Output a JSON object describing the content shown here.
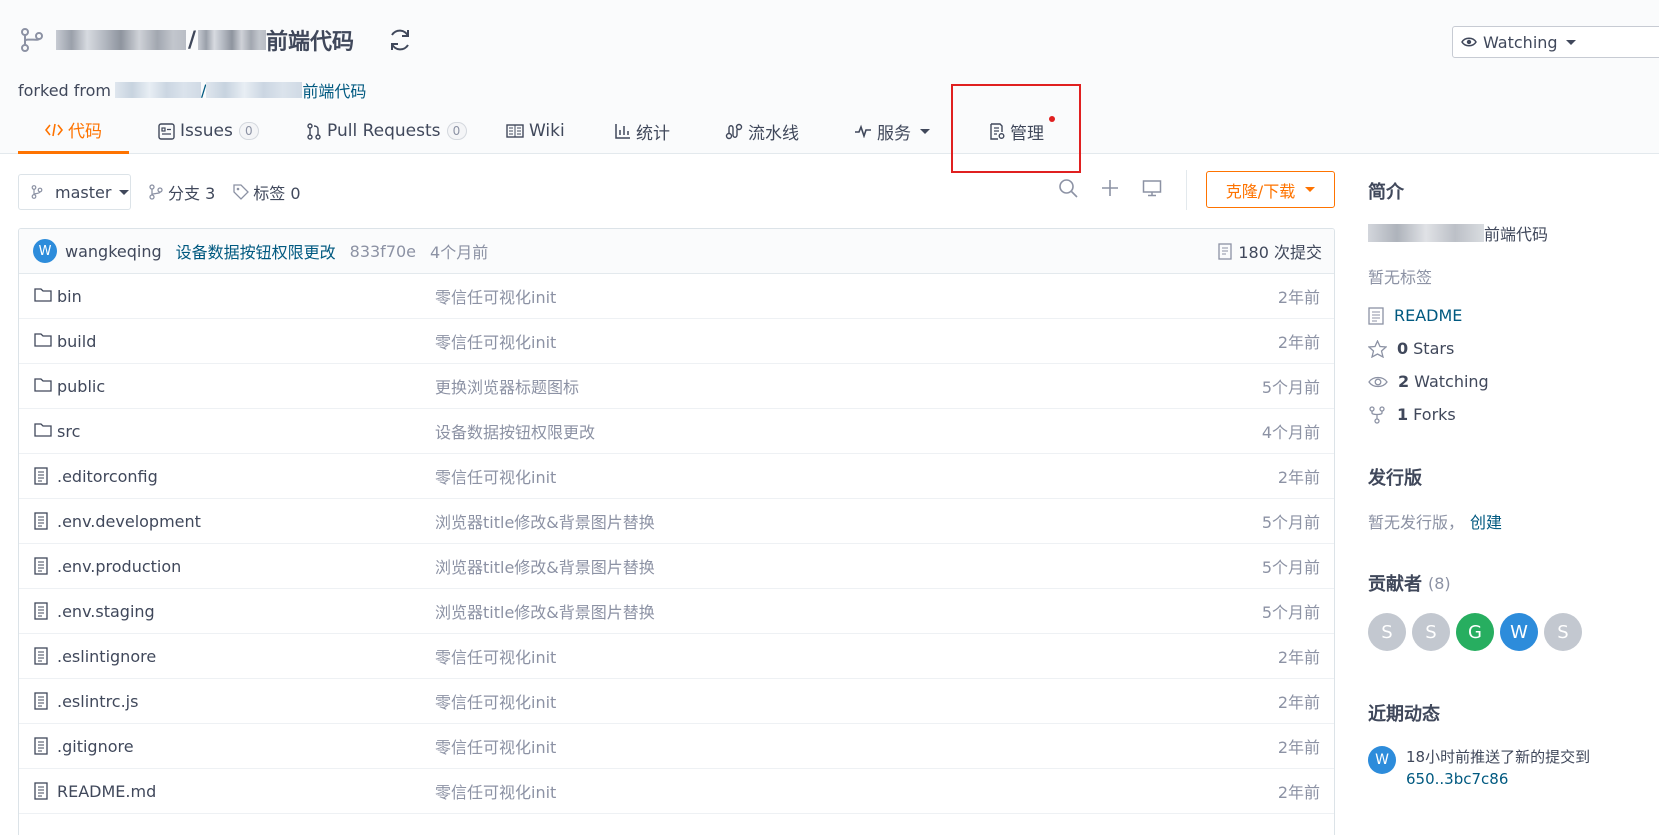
{
  "repo": {
    "title_suffix": "前端代码",
    "title_sep": "/",
    "forked_label": "forked from",
    "forked_sep": "/",
    "forked_suffix": "前端代码"
  },
  "watch": {
    "label": "Watching"
  },
  "tabs": [
    {
      "label": "代码",
      "icon": "code-icon",
      "active": true
    },
    {
      "label": "Issues",
      "icon": "issues-icon",
      "count": "0"
    },
    {
      "label": "Pull Requests",
      "icon": "pull-request-icon",
      "count": "0"
    },
    {
      "label": "Wiki",
      "icon": "wiki-icon"
    },
    {
      "label": "统计",
      "icon": "stats-icon"
    },
    {
      "label": "流水线",
      "icon": "pipeline-icon"
    },
    {
      "label": "服务",
      "icon": "service-icon"
    },
    {
      "label": "管理",
      "icon": "manage-icon"
    }
  ],
  "toolbar": {
    "branch": "master",
    "branches_label": "分支 3",
    "tags_label": "标签 0",
    "clone_label": "克隆/下载"
  },
  "latest_commit": {
    "avatar_letter": "W",
    "author": "wangkeqing",
    "message": "设备数据按钮权限更改",
    "hash": "833f70e",
    "time": "4个月前",
    "count_label": "180 次提交"
  },
  "files": [
    {
      "type": "folder",
      "name": "bin",
      "commit": "零信任可视化init",
      "time": "2年前"
    },
    {
      "type": "folder",
      "name": "build",
      "commit": "零信任可视化init",
      "time": "2年前"
    },
    {
      "type": "folder",
      "name": "public",
      "commit": "更换浏览器标题图标",
      "time": "5个月前"
    },
    {
      "type": "folder",
      "name": "src",
      "commit": "设备数据按钮权限更改",
      "time": "4个月前"
    },
    {
      "type": "file",
      "name": ".editorconfig",
      "commit": "零信任可视化init",
      "time": "2年前"
    },
    {
      "type": "file",
      "name": ".env.development",
      "commit": "浏览器title修改&背景图片替换",
      "time": "5个月前"
    },
    {
      "type": "file",
      "name": ".env.production",
      "commit": "浏览器title修改&背景图片替换",
      "time": "5个月前"
    },
    {
      "type": "file",
      "name": ".env.staging",
      "commit": "浏览器title修改&背景图片替换",
      "time": "5个月前"
    },
    {
      "type": "file",
      "name": ".eslintignore",
      "commit": "零信任可视化init",
      "time": "2年前"
    },
    {
      "type": "file",
      "name": ".eslintrc.js",
      "commit": "零信任可视化init",
      "time": "2年前"
    },
    {
      "type": "file",
      "name": ".gitignore",
      "commit": "零信任可视化init",
      "time": "2年前"
    },
    {
      "type": "file",
      "name": "README.md",
      "commit": "零信任可视化init",
      "time": "2年前"
    }
  ],
  "sidebar": {
    "intro_heading": "简介",
    "intro_suffix": "前端代码",
    "no_tags": "暂无标签",
    "readme": "README",
    "stars_count": "0",
    "stars_label": "Stars",
    "watching_count": "2",
    "watching_label": "Watching",
    "forks_count": "1",
    "forks_label": "Forks",
    "releases_heading": "发行版",
    "no_releases": "暂无发行版，",
    "create_link": "创建",
    "contributors_heading": "贡献者",
    "contributors_count": "(8)",
    "contributors": [
      {
        "letter": "S",
        "color": "#c3c8d0"
      },
      {
        "letter": "S",
        "color": "#c3c8d0"
      },
      {
        "letter": "G",
        "color": "#27ae60"
      },
      {
        "letter": "W",
        "color": "#2d8cdb"
      },
      {
        "letter": "S",
        "color": "#c3c8d0"
      }
    ],
    "activity_heading": "近期动态",
    "activity_avatar": "W",
    "activity_text": "18小时前推送了新的提交到",
    "activity_link": "650..3bc7c86"
  },
  "colors": {
    "accent": "#fe7300",
    "link": "#005980",
    "highlight": "#e02020"
  }
}
